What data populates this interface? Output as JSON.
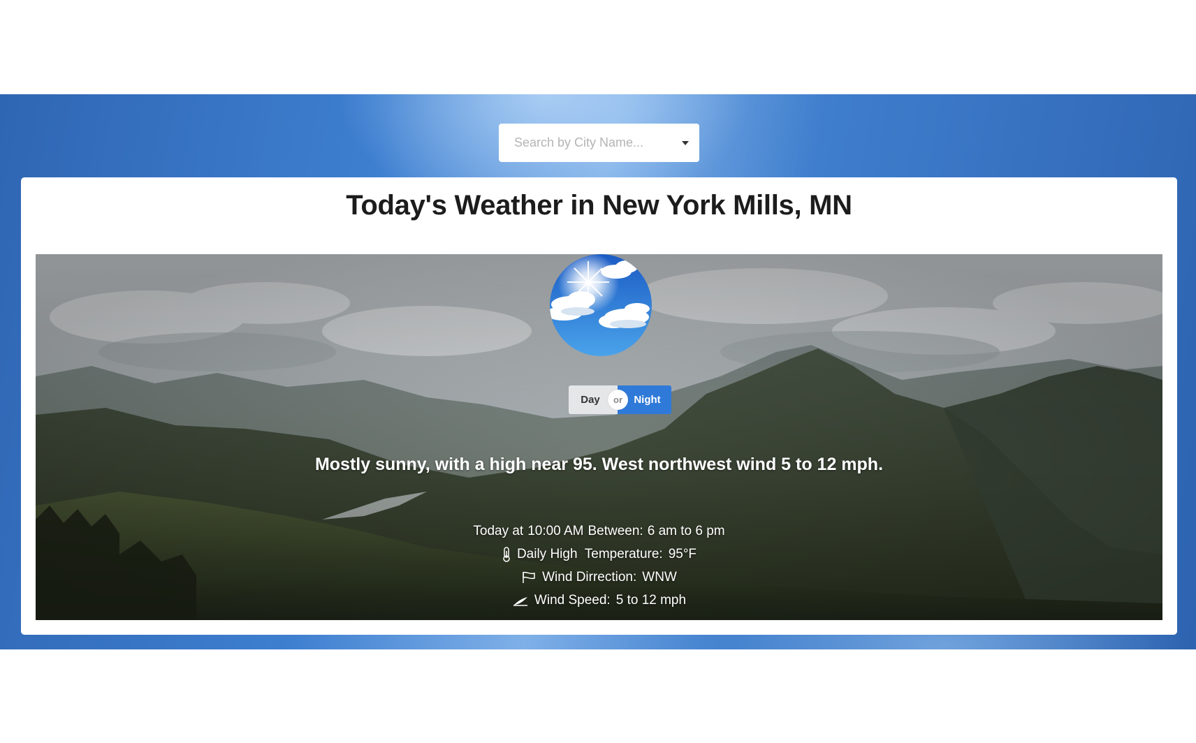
{
  "search": {
    "placeholder": "Search by City Name...",
    "value": ""
  },
  "card": {
    "title": "Today's Weather in New York Mills, MN"
  },
  "icons": {
    "weather": "sunny-clouds-icon",
    "temperature": "thermometer-icon",
    "direction": "flag-icon",
    "speed": "wind-icon",
    "dropdown": "caret-down-icon"
  },
  "toggle": {
    "day_label": "Day",
    "or_label": "or",
    "night_label": "Night",
    "active": "Night"
  },
  "forecast": {
    "summary": "Mostly sunny, with a high near 95. West northwest wind 5 to 12 mph.",
    "time_label": "Today at",
    "time_value": "10:00 AM",
    "range_label": "Between:",
    "range_value": "6 am to 6 pm",
    "temp_label": "Daily High  Temperature:",
    "temp_value": "95°F",
    "direction_label": "Wind Dirrection:",
    "direction_value": "WNW",
    "speed_label": "Wind Speed:",
    "speed_value": "5 to 12 mph"
  },
  "colors": {
    "band": "#3e7fd0",
    "toggle_active": "#2f7ad8",
    "toggle_inactive": "#e4e6e8",
    "title": "#1c1c1c"
  }
}
